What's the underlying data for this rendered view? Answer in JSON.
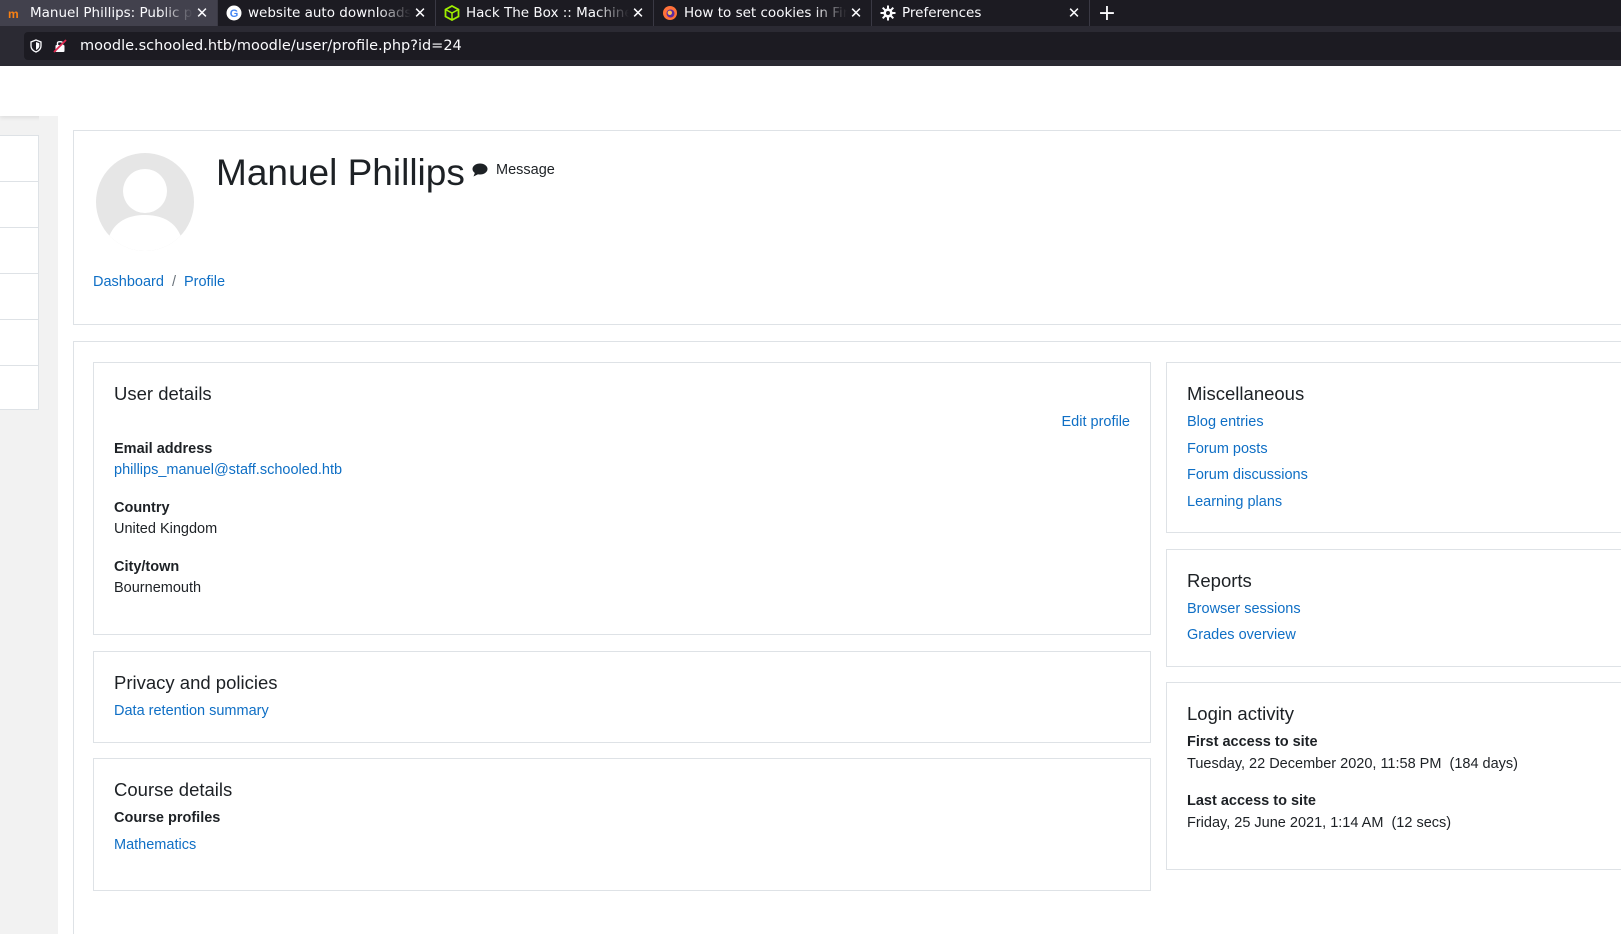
{
  "browser": {
    "tabs": [
      {
        "title": "Manuel Phillips: Public profile",
        "active": true
      },
      {
        "title": "website auto downloads",
        "active": false
      },
      {
        "title": "Hack The Box :: Machines",
        "active": false
      },
      {
        "title": "How to set cookies in Firefox",
        "active": false
      },
      {
        "title": "Preferences",
        "active": false
      }
    ],
    "url": "moodle.schooled.htb/moodle/user/profile.php?id=24"
  },
  "profile": {
    "name": "Manuel Phillips",
    "message_label": "Message"
  },
  "breadcrumb": {
    "items": [
      "Dashboard",
      "Profile"
    ],
    "separator": "/"
  },
  "user_details": {
    "heading": "User details",
    "edit_label": "Edit profile",
    "email_label": "Email address",
    "email_value": "phillips_manuel@staff.schooled.htb",
    "country_label": "Country",
    "country_value": "United Kingdom",
    "city_label": "City/town",
    "city_value": "Bournemouth"
  },
  "privacy": {
    "heading": "Privacy and policies",
    "link": "Data retention summary"
  },
  "course_details": {
    "heading": "Course details",
    "profiles_label": "Course profiles",
    "course": "Mathematics"
  },
  "misc": {
    "heading": "Miscellaneous",
    "links": [
      "Blog entries",
      "Forum posts",
      "Forum discussions",
      "Learning plans"
    ]
  },
  "reports": {
    "heading": "Reports",
    "links": [
      "Browser sessions",
      "Grades overview"
    ]
  },
  "login_activity": {
    "heading": "Login activity",
    "first_label": "First access to site",
    "first_value": "Tuesday, 22 December 2020, 11:58 PM  (184 days)",
    "last_label": "Last access to site",
    "last_value": "Friday, 25 June 2021, 1:14 AM  (12 secs)"
  },
  "colors": {
    "link": "#0f6fc5",
    "tabbar": "#1c1b22",
    "active_tab": "#42414d"
  }
}
